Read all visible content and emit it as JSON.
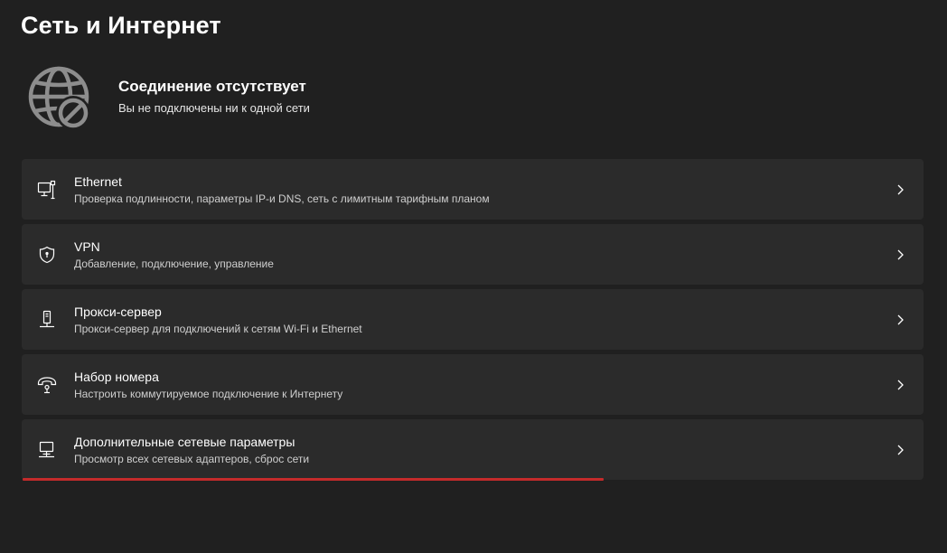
{
  "page": {
    "title": "Сеть и Интернет"
  },
  "status": {
    "icon": "globe-no-connection-icon",
    "title": "Соединение отсутствует",
    "subtitle": "Вы не подключены ни к одной сети"
  },
  "items": [
    {
      "icon": "ethernet-icon",
      "title": "Ethernet",
      "subtitle": "Проверка подлинности, параметры IP-и DNS, сеть с лимитным тарифным планом"
    },
    {
      "icon": "vpn-shield-icon",
      "title": "VPN",
      "subtitle": "Добавление, подключение, управление"
    },
    {
      "icon": "proxy-icon",
      "title": "Прокси-сервер",
      "subtitle": "Прокси-сервер для подключений к сетям Wi-Fi и Ethernet"
    },
    {
      "icon": "dial-up-phone-icon",
      "title": "Набор номера",
      "subtitle": "Настроить коммутируемое подключение к Интернету"
    },
    {
      "icon": "network-adapter-icon",
      "title": "Дополнительные сетевые параметры",
      "subtitle": "Просмотр всех сетевых адаптеров, сброс сети"
    }
  ],
  "colors": {
    "background": "#202020",
    "card": "#2b2b2b",
    "highlight_underline": "#c42b2b"
  }
}
